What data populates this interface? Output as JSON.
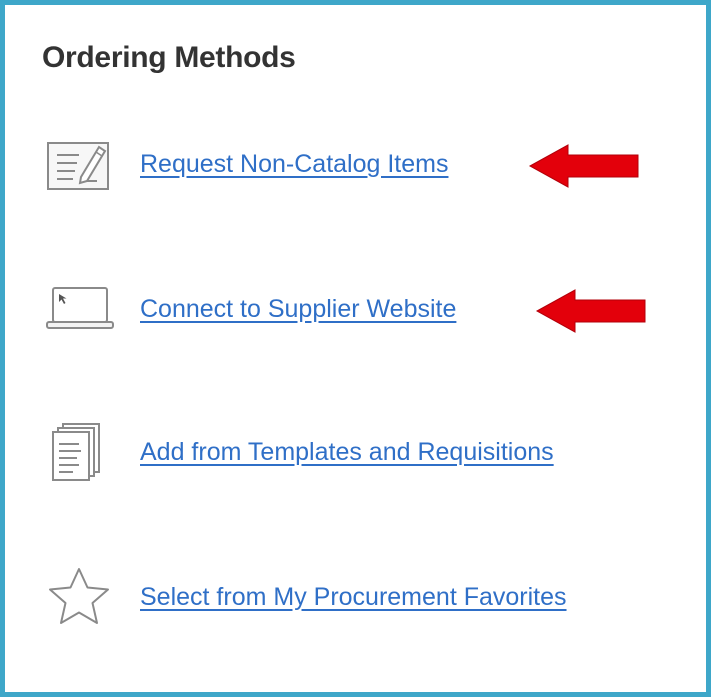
{
  "panel": {
    "title": "Ordering Methods"
  },
  "methods": [
    {
      "label": "Request Non-Catalog Items",
      "icon": "document-edit-icon",
      "highlighted": true
    },
    {
      "label": "Connect to Supplier Website",
      "icon": "laptop-icon",
      "highlighted": true
    },
    {
      "label": "Add from Templates and Requisitions",
      "icon": "document-stack-icon",
      "highlighted": false
    },
    {
      "label": "Select from My Procurement Favorites",
      "icon": "star-icon",
      "highlighted": false
    }
  ],
  "colors": {
    "frame_border": "#3ea7c9",
    "link": "#2f6fc7",
    "title": "#333333",
    "arrow": "#e3000b",
    "icon_stroke": "#8a8a8a"
  }
}
